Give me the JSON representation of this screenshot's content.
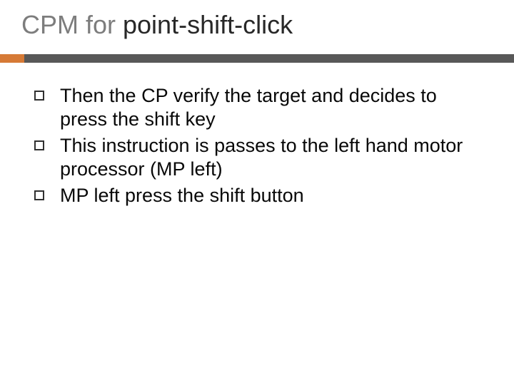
{
  "title": {
    "prefix": "CPM for ",
    "emphasis": "point-shift-click"
  },
  "bullets": [
    {
      "text": "Then the CP verify the target and decides to press the shift key"
    },
    {
      "text": "This instruction is passes to the left hand motor processor (MP left)"
    },
    {
      "text": "MP left press the shift button"
    }
  ]
}
